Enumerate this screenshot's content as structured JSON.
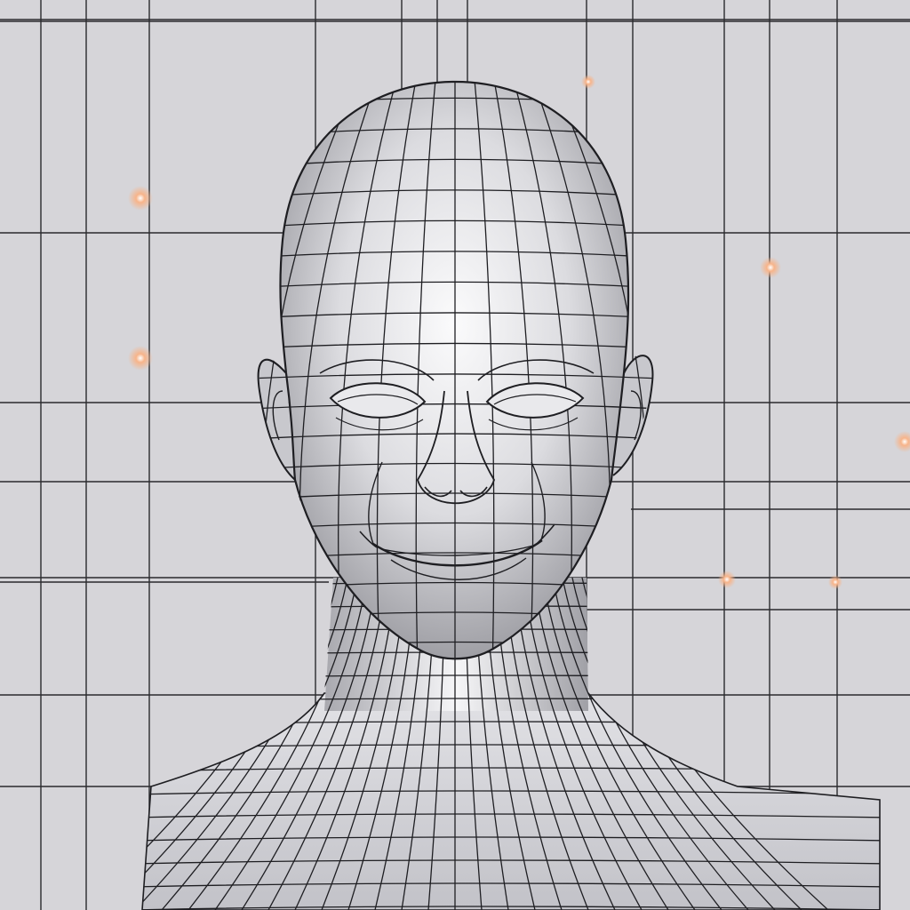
{
  "scene": {
    "subject": "wireframe-head",
    "colors": {
      "background": "#d6d5d9",
      "grid_line": "#2a2a2e",
      "mesh_line": "#1e1e22",
      "skin_light": "#f4f4f6",
      "skin_mid": "#c9c9cd",
      "skin_dark": "#8f8f95",
      "glow": "#f7b48a"
    }
  }
}
